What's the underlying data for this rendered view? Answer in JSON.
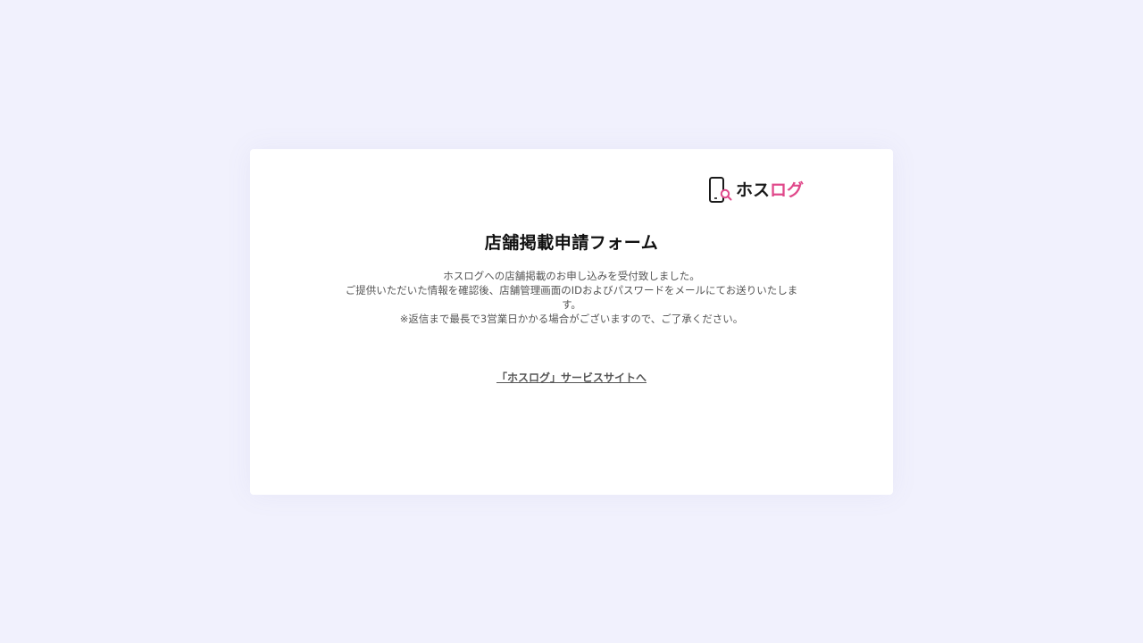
{
  "logo": {
    "text_dark": "ホス",
    "text_pink": "ログ",
    "accent_color": "#e0488a",
    "icon": "phone-search-icon"
  },
  "form": {
    "title": "店舗掲載申請フォーム",
    "message_lines": [
      "ホスログへの店舗掲載のお申し込みを受付致しました。",
      "ご提供いただいた情報を確認後、店舗管理画面のIDおよびパスワードをメールにてお送りいたしま",
      "す。",
      "※返信まで最長で3営業日かかる場合がございますので、ご了承ください。"
    ],
    "service_link": "「ホスログ」サービスサイトへ"
  },
  "colors": {
    "background": "#f1f1fd",
    "card": "#ffffff",
    "text": "#555555"
  }
}
